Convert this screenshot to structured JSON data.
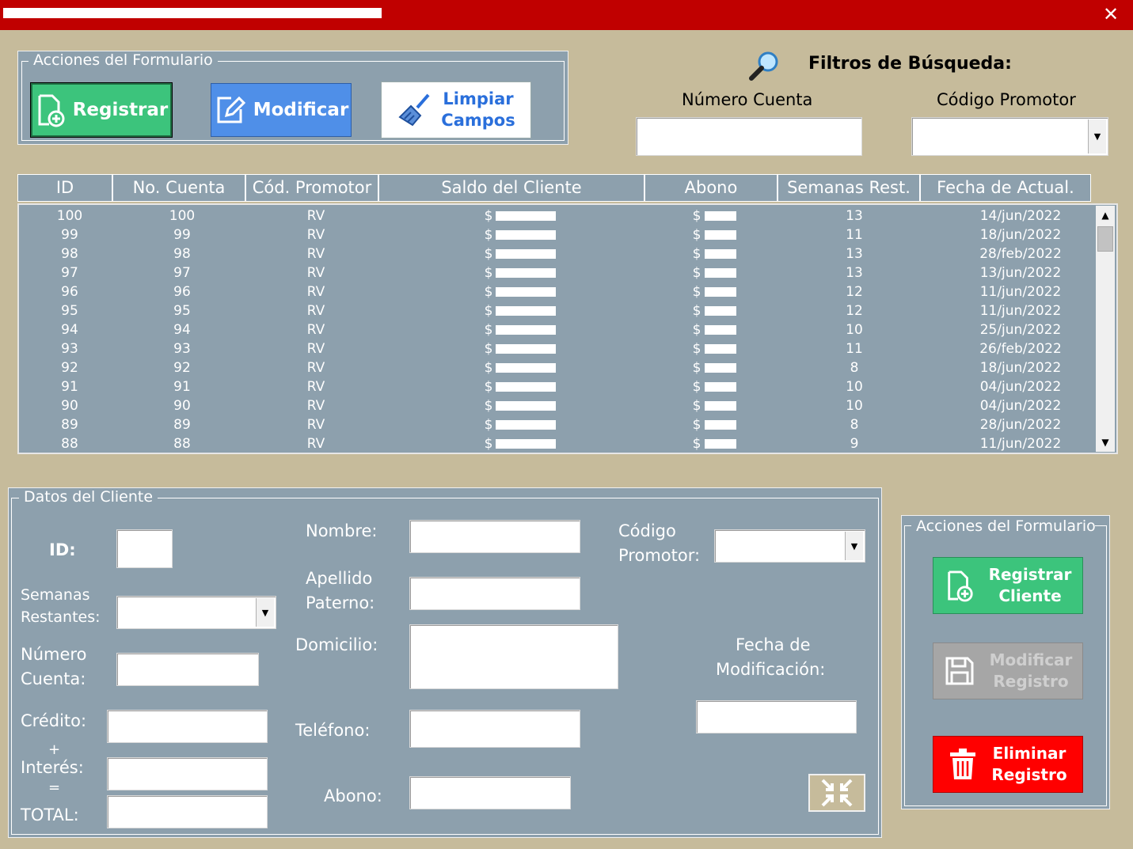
{
  "window": {
    "close_glyph": "✕"
  },
  "top_actions": {
    "legend": "Acciones del Formulario",
    "register_label": "Registrar",
    "modify_label": "Modificar",
    "clear_label_line1": "Limpiar",
    "clear_label_line2": "Campos"
  },
  "filters": {
    "title": "Filtros de Búsqueda:",
    "account_label": "Número Cuenta",
    "promoter_label": "Código Promotor",
    "account_value": "",
    "promoter_value": ""
  },
  "table": {
    "headers": [
      "ID",
      "No. Cuenta",
      "Cód. Promotor",
      "Saldo del Cliente",
      "Abono",
      "Semanas Rest.",
      "Fecha de Actual."
    ],
    "currency": "$",
    "rows": [
      {
        "id": "100",
        "cuenta": "100",
        "promotor": "RV",
        "semanas": "13",
        "fecha": "14/jun/2022"
      },
      {
        "id": "99",
        "cuenta": "99",
        "promotor": "RV",
        "semanas": "11",
        "fecha": "18/jun/2022"
      },
      {
        "id": "98",
        "cuenta": "98",
        "promotor": "RV",
        "semanas": "13",
        "fecha": "28/feb/2022"
      },
      {
        "id": "97",
        "cuenta": "97",
        "promotor": "RV",
        "semanas": "13",
        "fecha": "13/jun/2022"
      },
      {
        "id": "96",
        "cuenta": "96",
        "promotor": "RV",
        "semanas": "12",
        "fecha": "11/jun/2022"
      },
      {
        "id": "95",
        "cuenta": "95",
        "promotor": "RV",
        "semanas": "12",
        "fecha": "11/jun/2022"
      },
      {
        "id": "94",
        "cuenta": "94",
        "promotor": "RV",
        "semanas": "10",
        "fecha": "25/jun/2022"
      },
      {
        "id": "93",
        "cuenta": "93",
        "promotor": "RV",
        "semanas": "11",
        "fecha": "26/feb/2022"
      },
      {
        "id": "92",
        "cuenta": "92",
        "promotor": "RV",
        "semanas": "8",
        "fecha": "18/jun/2022"
      },
      {
        "id": "91",
        "cuenta": "91",
        "promotor": "RV",
        "semanas": "10",
        "fecha": "04/jun/2022"
      },
      {
        "id": "90",
        "cuenta": "90",
        "promotor": "RV",
        "semanas": "10",
        "fecha": "04/jun/2022"
      },
      {
        "id": "89",
        "cuenta": "89",
        "promotor": "RV",
        "semanas": "8",
        "fecha": "28/jun/2022"
      },
      {
        "id": "88",
        "cuenta": "88",
        "promotor": "RV",
        "semanas": "9",
        "fecha": "11/jun/2022"
      }
    ]
  },
  "client": {
    "legend": "Datos del Cliente",
    "id_label": "ID:",
    "weeks_line1": "Semanas",
    "weeks_line2": "Restantes:",
    "account_line1": "Número",
    "account_line2": "Cuenta:",
    "credit_label": "Crédito:",
    "plus": "+",
    "interest_label": "Interés:",
    "equals": "=",
    "total_label": "TOTAL:",
    "name_label": "Nombre:",
    "surname_line1": "Apellido",
    "surname_line2": "Paterno:",
    "address_label": "Domicilio:",
    "phone_label": "Teléfono:",
    "payment_label": "Abono:",
    "promoter_line1": "Código",
    "promoter_line2": "Promotor:",
    "modified_line1": "Fecha de",
    "modified_line2": "Modificación:"
  },
  "side_actions": {
    "legend": "Acciones del Formulario",
    "register_line1": "Registrar",
    "register_line2": "Cliente",
    "modify_line1": "Modificar",
    "modify_line2": "Registro",
    "delete_line1": "Eliminar",
    "delete_line2": "Registro"
  },
  "colors": {
    "title_bar": "#c00000",
    "background": "#c6bb9b",
    "panel": "#8da0ad",
    "register_green": "#3cc47c",
    "modify_blue": "#4f8fe8",
    "delete_red": "#ff0000",
    "disabled_gray": "#a6a6a6"
  }
}
